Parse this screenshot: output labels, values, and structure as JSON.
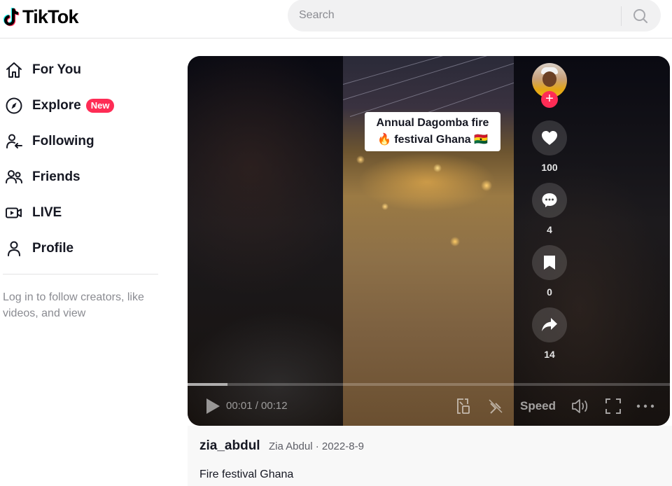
{
  "header": {
    "logo_text": "TikTok",
    "search": {
      "placeholder": "Search",
      "value": ""
    }
  },
  "sidebar": {
    "items": [
      {
        "label": "For You",
        "icon": "home-icon"
      },
      {
        "label": "Explore",
        "icon": "compass-icon",
        "badge": "New"
      },
      {
        "label": "Following",
        "icon": "following-icon"
      },
      {
        "label": "Friends",
        "icon": "friends-icon"
      },
      {
        "label": "LIVE",
        "icon": "live-icon"
      },
      {
        "label": "Profile",
        "icon": "profile-icon"
      }
    ],
    "login_hint": "Log in to follow creators, like videos, and view"
  },
  "video": {
    "caption": "Annual Dagomba fire 🔥 festival Ghana 🇬🇭",
    "caption_line1": "Annual Dagomba fire",
    "caption_line2": "🔥 festival Ghana 🇬🇭",
    "actions": {
      "likes": "100",
      "comments": "4",
      "saves": "0",
      "shares": "14"
    },
    "player": {
      "current_time": "00:01",
      "duration": "00:12",
      "time_display": "00:01 / 00:12",
      "progress": 0.083,
      "speed_label": "Speed"
    }
  },
  "post": {
    "username": "zia_abdul",
    "display_name": "Zia Abdul",
    "date": "2022-8-9",
    "meta": "Zia Abdul · 2022-8-9",
    "description": "Fire festival Ghana"
  },
  "colors": {
    "accent": "#fe2c55",
    "text_primary": "#161823",
    "text_secondary": "#8a8b91"
  }
}
